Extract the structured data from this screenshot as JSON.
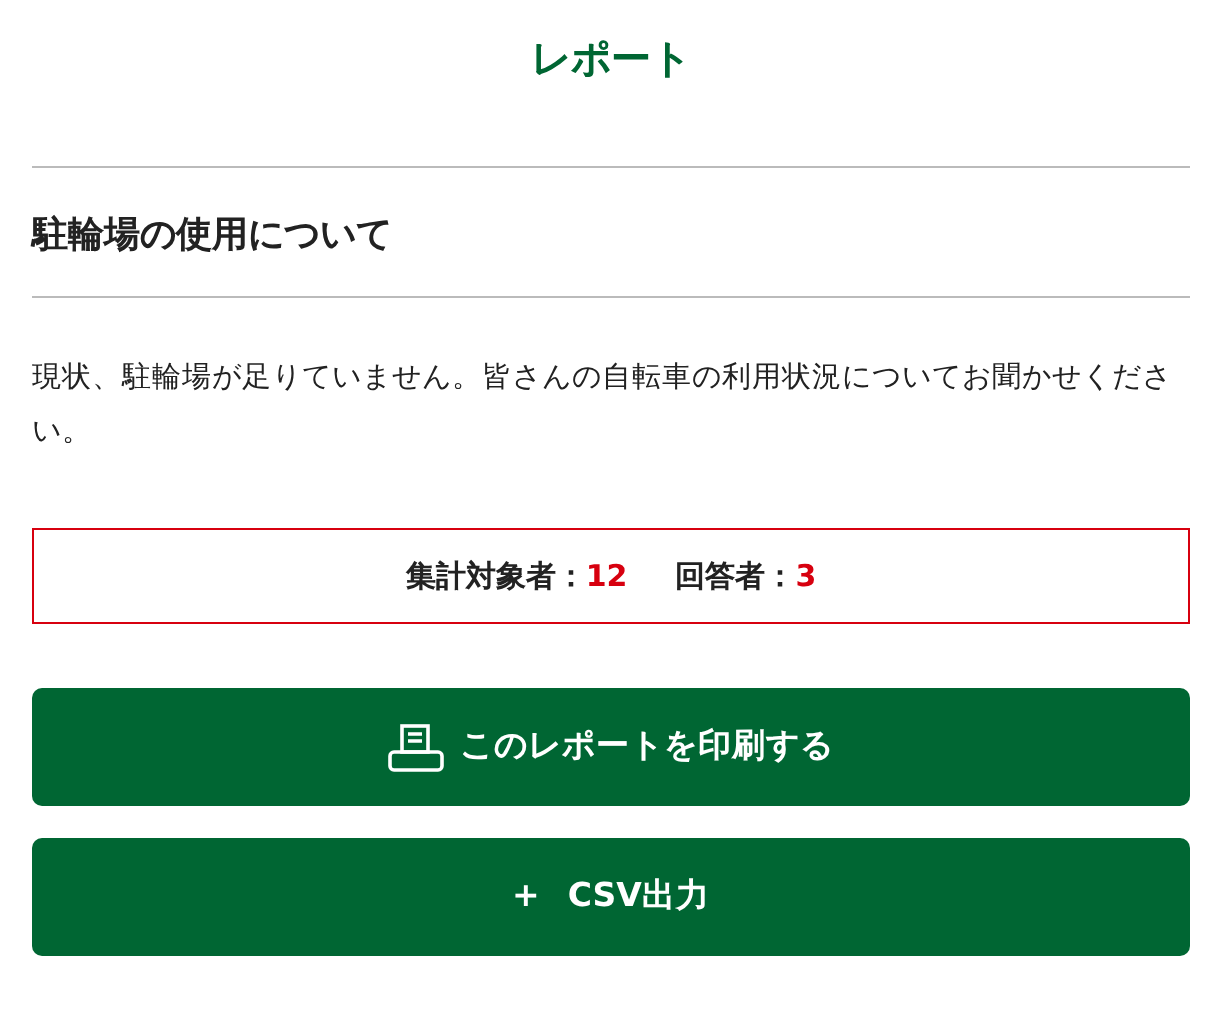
{
  "page_title": "レポート",
  "survey_title": "駐輪場の使用について",
  "description": "現状、駐輪場が足りていません。皆さんの自転車の利用状況についてお聞かせください。",
  "stats": [
    {
      "label": "集計対象者：",
      "value": "12"
    },
    {
      "label": "回答者：",
      "value": "3"
    }
  ],
  "buttons": [
    {
      "kind": "print",
      "label": "このレポートを印刷する"
    },
    {
      "kind": "csv",
      "icon": "+",
      "label": "CSV出力"
    }
  ]
}
